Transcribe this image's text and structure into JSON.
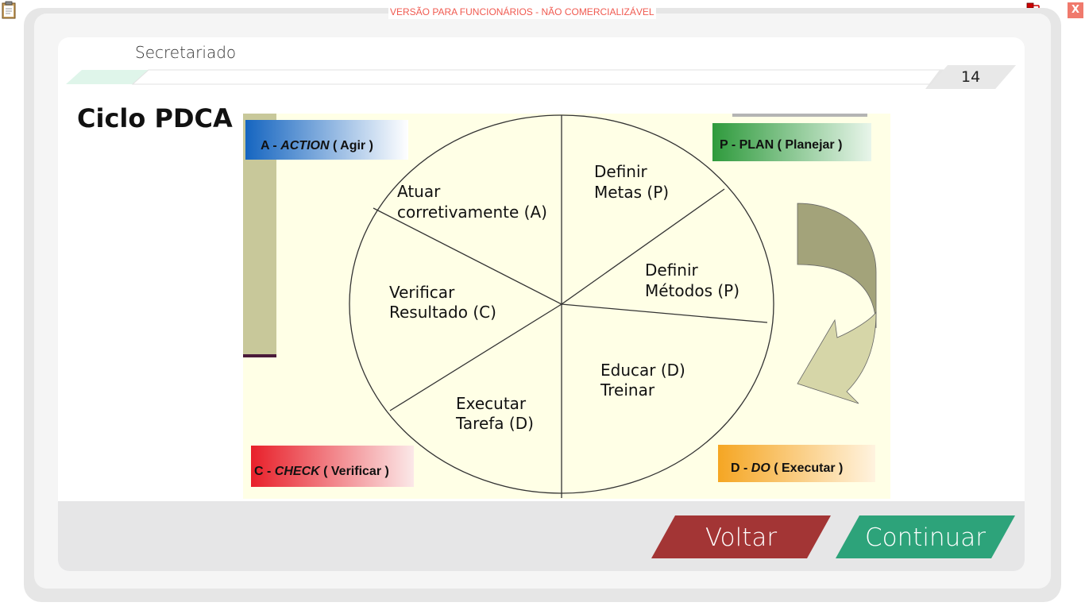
{
  "window": {
    "watermark": "VERSÃO PARA FUNCIONÁRIOS - NÃO COMERCIALIZÁVEL",
    "close_label": "X"
  },
  "header": {
    "course_name": "Secretariado",
    "page_number": "14"
  },
  "content": {
    "title": "Ciclo PDCA",
    "diagram": {
      "labels": {
        "action": {
          "prefix": "A - ",
          "keyword": "ACTION",
          "suffix": " ( Agir )"
        },
        "plan": {
          "prefix": "P - PLAN",
          "suffix": " ( Planejar )"
        },
        "check": {
          "prefix": "C - ",
          "keyword": "CHECK",
          "suffix": " ( Verificar )"
        },
        "do": {
          "prefix": "D - ",
          "keyword": "DO",
          "suffix": " ( Executar )"
        }
      },
      "segments": {
        "atuar": [
          "Atuar",
          "corretivamente (A)"
        ],
        "definir_metas": [
          "Definir",
          "Metas (P)"
        ],
        "definir_metodos": [
          "Definir",
          "Métodos (P)"
        ],
        "verificar": [
          "Verificar",
          "Resultado (C)"
        ],
        "educar": [
          "Educar (D)",
          "Treinar"
        ],
        "executar": [
          "Executar",
          "Tarefa (D)"
        ]
      },
      "colors": {
        "background": "#ffffe6",
        "action": "#1565c0",
        "plan": "#2e9a3c",
        "check": "#e8202a",
        "do": "#f5a623",
        "arrow": "#a3a37a"
      }
    }
  },
  "footer": {
    "back_label": "Voltar",
    "next_label": "Continuar",
    "back_color": "#a33535",
    "next_color": "#2da37a"
  }
}
